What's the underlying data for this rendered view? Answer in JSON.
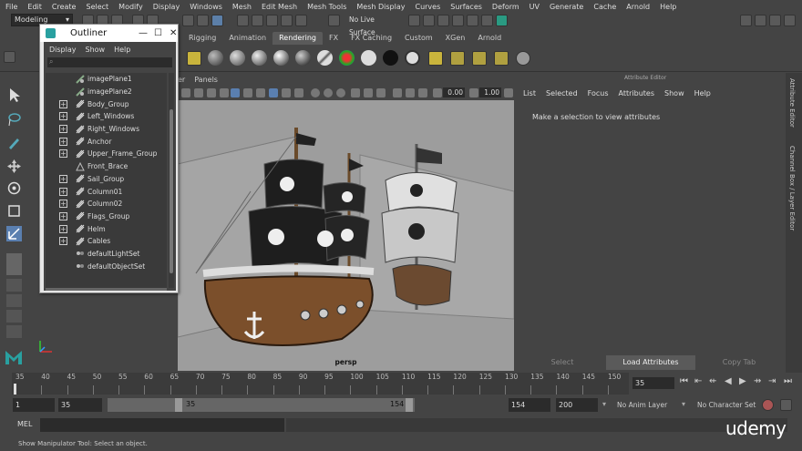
{
  "menubar": [
    "File",
    "Edit",
    "Create",
    "Select",
    "Modify",
    "Display",
    "Windows",
    "Mesh",
    "Edit Mesh",
    "Mesh Tools",
    "Mesh Display",
    "Curves",
    "Surfaces",
    "Deform",
    "UV",
    "Generate",
    "Cache",
    "Arnold",
    "Help"
  ],
  "statusline": {
    "mode": "Modeling",
    "live_surface": "No Live Surface"
  },
  "shelf_tabs": [
    "Rigging",
    "Animation",
    "Rendering",
    "FX",
    "FX Caching",
    "Custom",
    "XGen",
    "Arnold"
  ],
  "shelf_active": "Rendering",
  "viewport": {
    "menu": [
      "er",
      "Panels"
    ],
    "near_value": "0.00",
    "far_value": "1.00",
    "camera_label": "persp"
  },
  "outliner": {
    "title": "Outliner",
    "menu": [
      "Display",
      "Show",
      "Help"
    ],
    "items": [
      {
        "label": "imagePlane1",
        "expand": false,
        "icon": "image-plane-icon"
      },
      {
        "label": "imagePlane2",
        "expand": false,
        "icon": "image-plane-icon"
      },
      {
        "label": "Body_Group",
        "expand": true,
        "icon": "group-icon"
      },
      {
        "label": "Left_Windows",
        "expand": true,
        "icon": "group-icon"
      },
      {
        "label": "Right_Windows",
        "expand": true,
        "icon": "group-icon"
      },
      {
        "label": "Anchor",
        "expand": true,
        "icon": "group-icon"
      },
      {
        "label": "Upper_Frame_Group",
        "expand": true,
        "icon": "group-icon"
      },
      {
        "label": "Front_Brace",
        "expand": false,
        "icon": "mesh-icon"
      },
      {
        "label": "Sail_Group",
        "expand": true,
        "icon": "group-icon"
      },
      {
        "label": "Column01",
        "expand": true,
        "icon": "group-icon"
      },
      {
        "label": "Column02",
        "expand": true,
        "icon": "group-icon"
      },
      {
        "label": "Flags_Group",
        "expand": true,
        "icon": "group-icon"
      },
      {
        "label": "Helm",
        "expand": true,
        "icon": "group-icon"
      },
      {
        "label": "Cables",
        "expand": true,
        "icon": "group-icon"
      },
      {
        "label": "defaultLightSet",
        "expand": false,
        "icon": "set-icon"
      },
      {
        "label": "defaultObjectSet",
        "expand": false,
        "icon": "set-icon"
      }
    ]
  },
  "attribute_editor": {
    "header": "Attribute Editor",
    "menu": [
      "List",
      "Selected",
      "Focus",
      "Attributes",
      "Show",
      "Help"
    ],
    "message": "Make a selection to view attributes",
    "buttons": [
      "Select",
      "Load Attributes",
      "Copy Tab"
    ],
    "side_tabs": [
      "Attribute Editor",
      "Channel Box / Layer Editor"
    ]
  },
  "timeslider": {
    "ticks": [
      "35",
      "40",
      "45",
      "50",
      "55",
      "60",
      "65",
      "70",
      "75",
      "80",
      "85",
      "90",
      "95",
      "100",
      "105",
      "110",
      "115",
      "120",
      "125",
      "130",
      "135",
      "140",
      "145",
      "150"
    ],
    "current_frame": "35"
  },
  "range": {
    "start": "1",
    "playback_start": "35",
    "slider_start": "35",
    "slider_end": "154",
    "playback_end": "154",
    "end": "200",
    "anim_layer": "No Anim Layer",
    "char_set": "No Character Set"
  },
  "mel": {
    "label": "MEL"
  },
  "helpline": "Show Manipulator Tool: Select an object.",
  "watermark": "udemy",
  "colors": {
    "accent_active_tab": "#5a5a5a",
    "viewport_bg": "#9d9d9d",
    "outliner_title": "#ffffff"
  }
}
